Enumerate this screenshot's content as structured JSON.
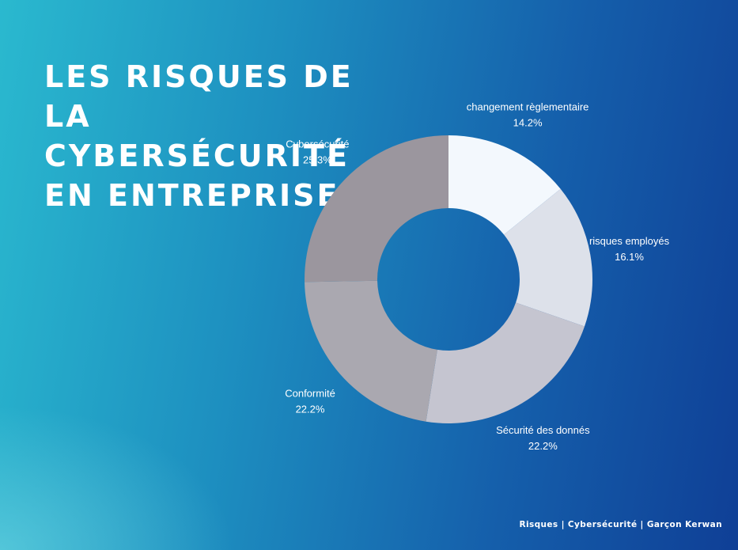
{
  "title_lines": [
    "LES RISQUES DE",
    "LA",
    "CYBERSÉCURITÉ",
    "EN ENTREPRISE"
  ],
  "footer": "Risques | Cybersécurité | Garçon Kerwan",
  "chart_data": {
    "type": "pie",
    "style": "donut",
    "start": "top",
    "direction": "clockwise",
    "slices": [
      {
        "label": "changement règlementaire",
        "value": 14.2,
        "value_label": "14.2%",
        "color": "#f3f8fd"
      },
      {
        "label": "risques employés",
        "value": 16.1,
        "value_label": "16.1%",
        "color": "#dde1ea"
      },
      {
        "label": "Sécurité des donnés",
        "value": 22.2,
        "value_label": "22.2%",
        "color": "#c5c5d0"
      },
      {
        "label": "Conformité",
        "value": 22.2,
        "value_label": "22.2%",
        "color": "#aaa8b0"
      },
      {
        "label": "Cybersécurité",
        "value": 25.3,
        "value_label": "25.3%",
        "color": "#9b969e"
      }
    ]
  }
}
